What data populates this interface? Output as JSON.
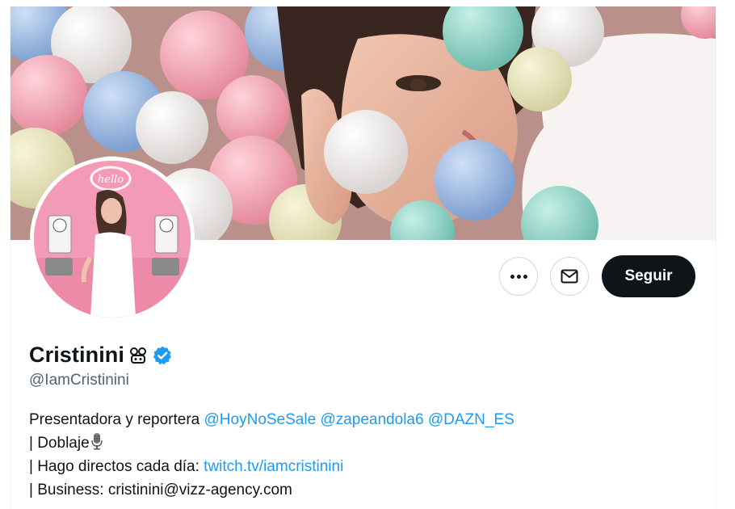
{
  "profile": {
    "name": "Cristinini",
    "name_emoji_icon": "dragon-face-icon",
    "verified_icon": "verified-badge-icon",
    "handle": "@IamCristinini",
    "avatar_sign_text": "hello"
  },
  "actions": {
    "more_icon": "more-dots-icon",
    "message_icon": "envelope-icon",
    "follow_label": "Seguir"
  },
  "bio": {
    "line1_text": "Presentadora y reportera ",
    "mentions": [
      "@HoyNoSeSale",
      "@zapeandola6",
      "@DAZN_ES"
    ],
    "line2_text": "| Doblaje",
    "line2_icon": "microphone-icon",
    "line3_text": "| Hago directos cada día: ",
    "line3_link": "twitch.tv/iamcristinini",
    "line4_text": "| Business: cristinini@vizz-agency.com"
  },
  "colors": {
    "link": "#1d9bf0",
    "verified": "#1d9bf0",
    "follow_bg": "#0f1419",
    "handle": "#536471"
  }
}
